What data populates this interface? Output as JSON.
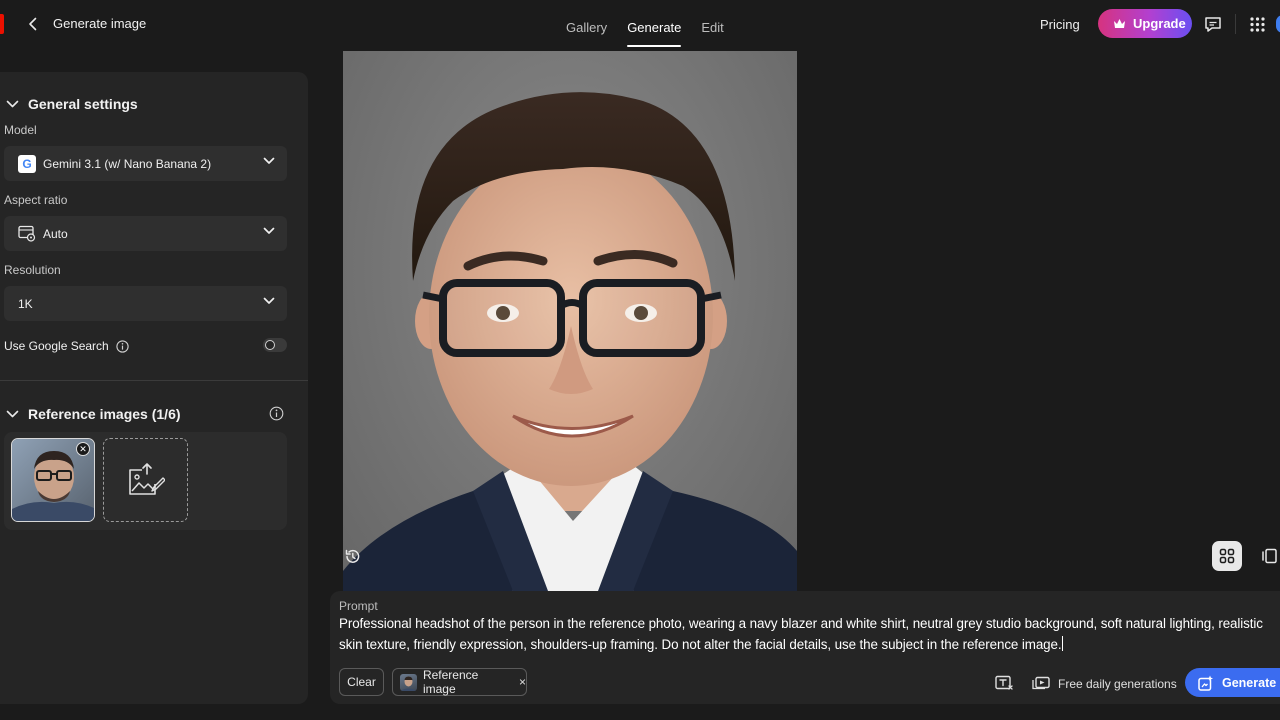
{
  "header": {
    "title": "Generate image",
    "nav_tabs": [
      {
        "label": "Gallery"
      },
      {
        "label": "Generate",
        "active": true
      },
      {
        "label": "Edit"
      }
    ],
    "pricing_label": "Pricing",
    "upgrade_label": "Upgrade"
  },
  "sidebar": {
    "general_settings_title": "General settings",
    "model": {
      "label": "Model",
      "value": "Gemini 3.1 (w/ Nano Banana 2)",
      "icon": "google-logo-icon"
    },
    "aspect_ratio": {
      "label": "Aspect ratio",
      "value": "Auto",
      "icon": "aspect-ratio-icon"
    },
    "resolution": {
      "label": "Resolution",
      "value": "1K"
    },
    "google_search": {
      "label": "Use Google Search",
      "enabled": false
    },
    "reference_images": {
      "title": "Reference images (1/6)",
      "count": 1,
      "max": 6
    }
  },
  "prompt": {
    "label": "Prompt",
    "text": "Professional headshot of the person in the reference photo, wearing a navy blazer and white shirt, neutral grey studio background, soft natural lighting, realistic skin texture, friendly expression, shoulders-up framing. Do not alter the facial details, use the subject in the reference image.",
    "clear_label": "Clear",
    "chip_label": "Reference image",
    "chip_remove": "×",
    "free_label": "Free daily generations",
    "generate_label": "Generate"
  },
  "colors": {
    "accent_blue": "#3b6cf0",
    "upgrade_gradient_start": "#d6337f",
    "upgrade_gradient_end": "#6a4ff2",
    "brand_red": "#eb1000"
  }
}
